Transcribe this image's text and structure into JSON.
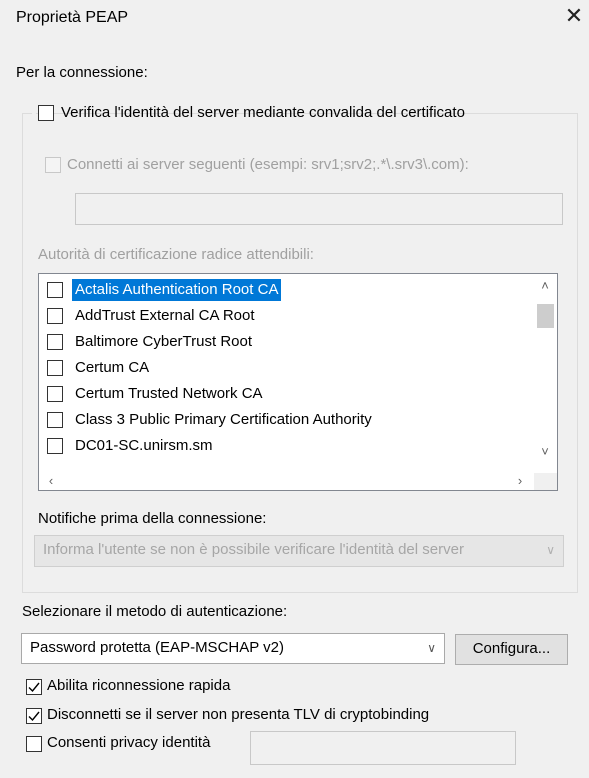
{
  "window": {
    "title": "Proprietà PEAP",
    "close_glyph": "✕"
  },
  "connection_label": "Per la connessione:",
  "verify_server": {
    "label": "Verifica l'identità del server mediante convalida del certificato",
    "checked": false
  },
  "connect_servers": {
    "label": "Connetti ai server seguenti (esempi: srv1;srv2;.*\\.srv3\\.com):",
    "checked": false,
    "disabled": true,
    "value": ""
  },
  "trusted_roots": {
    "label": "Autorità di certificazione radice attendibili:",
    "items": [
      {
        "label": "Actalis Authentication Root CA",
        "checked": false,
        "selected": true
      },
      {
        "label": "AddTrust External CA Root",
        "checked": false,
        "selected": false
      },
      {
        "label": "Baltimore CyberTrust Root",
        "checked": false,
        "selected": false
      },
      {
        "label": "Certum CA",
        "checked": false,
        "selected": false
      },
      {
        "label": "Certum Trusted Network CA",
        "checked": false,
        "selected": false
      },
      {
        "label": "Class 3 Public Primary Certification Authority",
        "checked": false,
        "selected": false
      },
      {
        "label": "DC01-SC.unirsm.sm",
        "checked": false,
        "selected": false
      }
    ]
  },
  "notifications": {
    "label": "Notifiche prima della connessione:",
    "selected": "Informa l'utente se non è possibile verificare l'identità del server",
    "disabled": true
  },
  "auth_method": {
    "label": "Selezionare il metodo di autenticazione:",
    "selected": "Password protetta (EAP-MSCHAP v2)",
    "configure_label": "Configura..."
  },
  "options": {
    "fast_reconnect": {
      "label": "Abilita riconnessione rapida",
      "checked": true
    },
    "cryptobinding": {
      "label": "Disconnetti se il server non presenta TLV di cryptobinding",
      "checked": true
    },
    "identity_privacy": {
      "label": "Consenti privacy identità",
      "checked": false,
      "value": ""
    }
  },
  "colors": {
    "selection": "#0078d7",
    "background": "#f0f0f0"
  }
}
